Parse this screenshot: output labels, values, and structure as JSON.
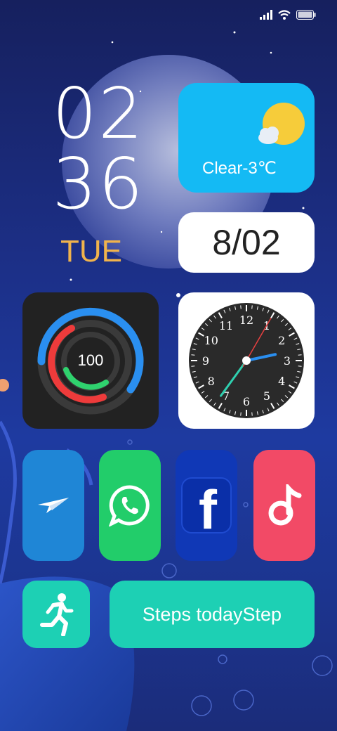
{
  "status_bar": {
    "icons": [
      "signal-icon",
      "wifi-icon",
      "battery-icon"
    ]
  },
  "clock": {
    "hours": "02",
    "minutes": "36",
    "day": "TUE"
  },
  "weather": {
    "text": "Clear-3℃",
    "icon": "sun-cloud-icon"
  },
  "date": {
    "text": "8/02"
  },
  "fitness": {
    "value": "100"
  },
  "analog_clock": {
    "numbers": [
      "12",
      "1",
      "2",
      "3",
      "4",
      "5",
      "6",
      "7",
      "8",
      "9",
      "10",
      "11"
    ],
    "hour": 2,
    "minute": 36,
    "second": 5
  },
  "apps": [
    {
      "name": "Telegram",
      "icon": "paper-plane-icon",
      "color": "#1f86d6"
    },
    {
      "name": "WhatsApp",
      "icon": "whatsapp-icon",
      "color": "#22cd6a"
    },
    {
      "name": "Facebook",
      "icon": "facebook-icon",
      "color": "#1038b6"
    },
    {
      "name": "Music",
      "icon": "music-note-icon",
      "color": "#f24a66"
    }
  ],
  "steps": {
    "label": "Steps todayStep",
    "icon": "running-icon"
  },
  "colors": {
    "accent_day": "#f0b34c",
    "weather_bg": "#14baf4",
    "steps_bg": "#1dd0b4"
  }
}
